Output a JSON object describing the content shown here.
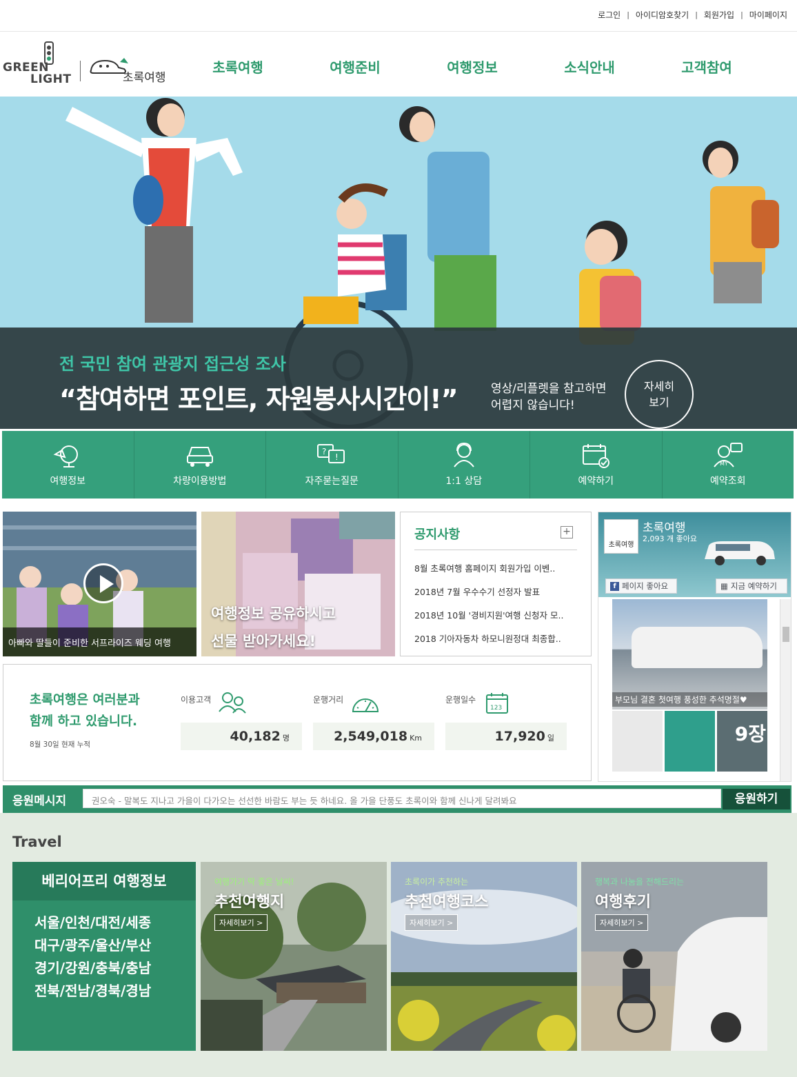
{
  "util": {
    "login": "로그인",
    "find_id": "아이디암호찾기",
    "join": "회원가입",
    "mypage": "마이페이지",
    "sep": "|"
  },
  "logo": {
    "green": "GREEN",
    "light": "LIGHT",
    "brand": "초록여행"
  },
  "gnb": [
    "초록여행",
    "여행준비",
    "여행정보",
    "소식안내",
    "고객참여"
  ],
  "hero": {
    "subtitle": "전 국민 참여 관광지 접근성 조사",
    "title": "“참여하면 포인트, 자원봉사시간이!”",
    "desc_line1": "영상/리플렛을 참고하면",
    "desc_line2": "어렵지 않습니다!",
    "btn_line1": "자세히",
    "btn_line2": "보기"
  },
  "quick": [
    {
      "label": "여행정보",
      "icon": "travel-info-icon"
    },
    {
      "label": "차량이용방법",
      "icon": "car-icon"
    },
    {
      "label": "자주묻는질문",
      "icon": "faq-icon"
    },
    {
      "label": "1:1 상담",
      "icon": "consult-icon"
    },
    {
      "label": "예약하기",
      "icon": "calendar-check-icon"
    },
    {
      "label": "예약조회",
      "icon": "my-reservation-icon"
    }
  ],
  "thumbs": {
    "video_caption": "아빠와 딸들이 준비한 서프라이즈 웨딩 여행",
    "event_line1": "여행정보 공유하시고",
    "event_line2": "선물 받아가세요!"
  },
  "notice": {
    "title": "공지사항",
    "plus": "+",
    "items": [
      "8월 초록여행 홈페이지 회원가입 이벤..",
      "2018년 7월 우수수기 선정자 발표",
      "2018년 10월 '경비지원'여행 신청자 모..",
      "2018 기아자동차 하모니원정대 최종합.."
    ]
  },
  "facebook": {
    "name": "초록여행",
    "likes": "2,093 개 좋아요",
    "avatar_text": "초록여행",
    "like_btn": "페이지 좋아요",
    "like_icon": "f",
    "book_btn": "지금 예약하기",
    "post_caption": "부모님 결혼 첫여행 풍성한 추석명절♥",
    "photo_count": "9장"
  },
  "stats": {
    "headline_line1": "초록여행은 여러분과",
    "headline_line2": "함께 하고 있습니다.",
    "asof": "8월 30일 현재 누적",
    "items": [
      {
        "label": "이용고객",
        "value": "40,182",
        "unit": "명",
        "icon": "users-icon"
      },
      {
        "label": "운행거리",
        "value": "2,549,018",
        "unit": "Km",
        "icon": "speedometer-icon"
      },
      {
        "label": "운행일수",
        "value": "17,920",
        "unit": "일",
        "icon": "calendar-123-icon"
      }
    ]
  },
  "cheer": {
    "label": "응원메시지",
    "message": "권오숙 - 말복도 지나고 가을이 다가오는 선선한 바람도 부는 듯 하네요. 올 가을 단풍도 초록이와 함께 신나게 달려봐요",
    "button": "응원하기"
  },
  "travel": {
    "title": "Travel",
    "barrier_free": {
      "title": "베리어프리 여행정보",
      "regions": [
        "서울/인천/대전/세종",
        "대구/광주/울산/부산",
        "경기/강원/충북/충남",
        "전북/전남/경북/경남"
      ]
    },
    "cards": [
      {
        "kicker": "여행가기 딱 좋은 날씨!",
        "title": "추천여행지",
        "more": "자세히보기 >",
        "kicker_color": "#9cf27a"
      },
      {
        "kicker": "초록이가 추천하는",
        "title": "추천여행코스",
        "more": "자세히보기 >",
        "kicker_color": "#c9f0a0"
      },
      {
        "kicker": "행복과 나눔을 전해드리는",
        "title": "여행후기",
        "more": "자세히보기 >",
        "kicker_color": "#7fe0a8"
      }
    ]
  },
  "colors": {
    "brand_green": "#2e9a6d",
    "quick_bg": "#35a07c",
    "dark_green": "#16513a",
    "hero_sky": "#a5dbea"
  }
}
